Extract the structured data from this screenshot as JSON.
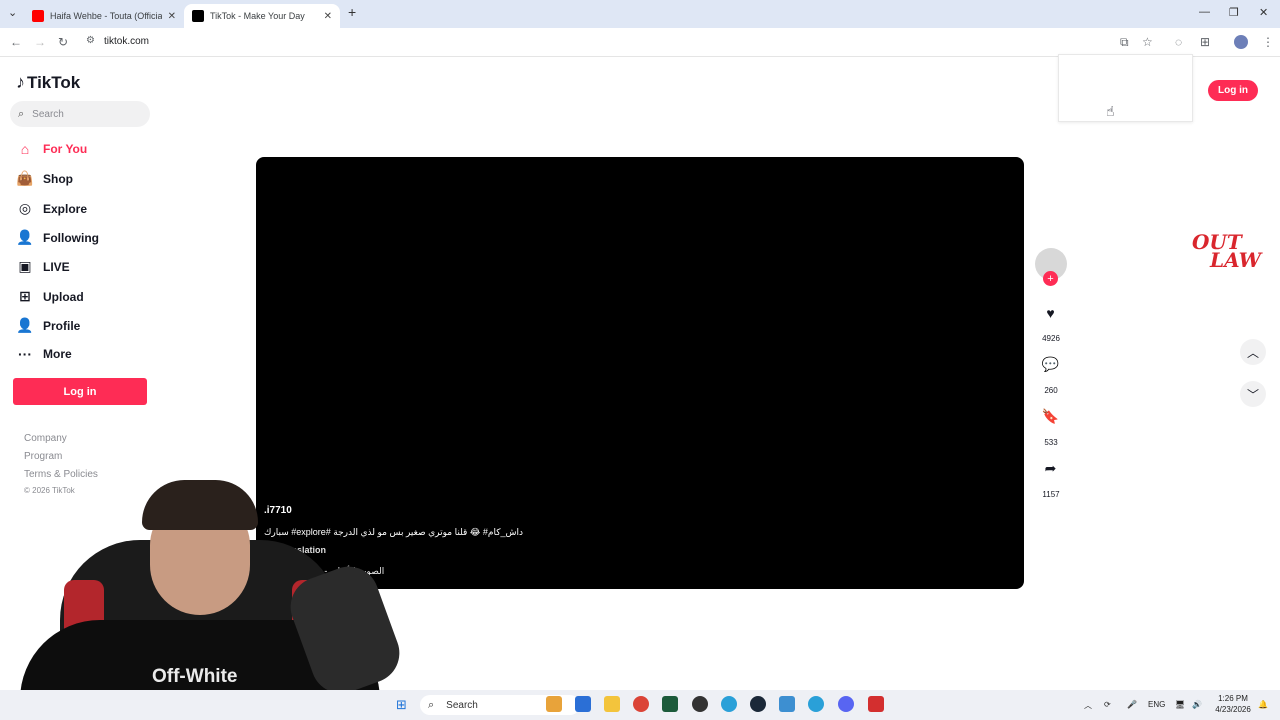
{
  "browser": {
    "tabs": [
      {
        "title": "Haifa Wehbe - Touta (Official M",
        "active": false
      },
      {
        "title": "TikTok - Make Your Day",
        "active": true
      }
    ],
    "url": "tiktok.com"
  },
  "sidebar": {
    "logo": "TikTok",
    "search_placeholder": "Search",
    "nav": [
      {
        "label": "For You",
        "icon": "home-icon",
        "active": true
      },
      {
        "label": "Shop",
        "icon": "shopping-bag-icon"
      },
      {
        "label": "Explore",
        "icon": "compass-icon"
      },
      {
        "label": "Following",
        "icon": "following-icon"
      },
      {
        "label": "LIVE",
        "icon": "live-tv-icon"
      },
      {
        "label": "Upload",
        "icon": "upload-plus-icon"
      },
      {
        "label": "Profile",
        "icon": "profile-icon"
      },
      {
        "label": "More",
        "icon": "more-dots-icon"
      }
    ],
    "login_label": "Log in",
    "footer": [
      "Company",
      "Program",
      "Terms & Policies"
    ],
    "copyright": "© 2026 TikTok"
  },
  "header": {
    "login_label": "Log in"
  },
  "video": {
    "username": ".i7710",
    "caption": "سبارك #explore# داش_كام# 😂 قلنا موتري صغير بس مو لذي الدرجة",
    "translation": "translation",
    "sound": "الصوت الأصلي - عباس"
  },
  "actions": {
    "likes": "4926",
    "comments": "260",
    "saves": "533",
    "shares": "1157"
  },
  "watermark": {
    "line1": "OUT",
    "line2": "LAW"
  },
  "webcam": {
    "shirt_text": "Off-White"
  },
  "taskbar": {
    "search": "Search",
    "lang": "ENG",
    "time": "1:26 PM",
    "date": "4/23/2026"
  },
  "colors": {
    "accent": "#fe2c55",
    "video_bg": "#000000"
  }
}
